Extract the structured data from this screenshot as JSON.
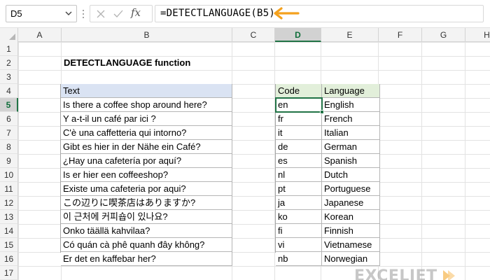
{
  "formula_bar": {
    "name_box": "D5",
    "formula": "=DETECTLANGUAGE(B5)",
    "fx_label": "fx",
    "accent": "#f4a11d"
  },
  "columns": [
    "A",
    "B",
    "C",
    "D",
    "E",
    "F",
    "G",
    "H"
  ],
  "active_column": "D",
  "rows": [
    "1",
    "2",
    "3",
    "4",
    "5",
    "6",
    "7",
    "8",
    "9",
    "10",
    "11",
    "12",
    "13",
    "14",
    "15",
    "16",
    "17"
  ],
  "active_row": "5",
  "title": "DETECTLANGUAGE function",
  "text_table": {
    "header": "Text",
    "items": [
      "Is there a coffee shop around here?",
      "Y a-t-il un café par ici ?",
      "C'è una caffetteria qui intorno?",
      "Gibt es hier in der Nähe ein Café?",
      "¿Hay una cafetería por aquí?",
      "Is er hier een coffeeshop?",
      "Existe uma cafeteria por aqui?",
      "この辺りに喫茶店はありますか?",
      "이 근처에 커피숍이 있나요?",
      "Onko täällä kahvilaa?",
      "Có quán cà phê quanh đây không?",
      "Er det en kaffebar her?"
    ]
  },
  "code_table": {
    "header_code": "Code",
    "header_language": "Language",
    "items": [
      {
        "code": "en",
        "language": "English"
      },
      {
        "code": "fr",
        "language": "French"
      },
      {
        "code": "it",
        "language": "Italian"
      },
      {
        "code": "de",
        "language": "German"
      },
      {
        "code": "es",
        "language": "Spanish"
      },
      {
        "code": "nl",
        "language": "Dutch"
      },
      {
        "code": "pt",
        "language": "Portuguese"
      },
      {
        "code": "ja",
        "language": "Japanese"
      },
      {
        "code": "ko",
        "language": "Korean"
      },
      {
        "code": "fi",
        "language": "Finnish"
      },
      {
        "code": "vi",
        "language": "Vietnamese"
      },
      {
        "code": "nb",
        "language": "Norwegian"
      }
    ]
  },
  "watermark": "EXCELJET",
  "colors": {
    "text_header": "#dae3f3",
    "code_header": "#e2efda",
    "selection": "#217346"
  }
}
